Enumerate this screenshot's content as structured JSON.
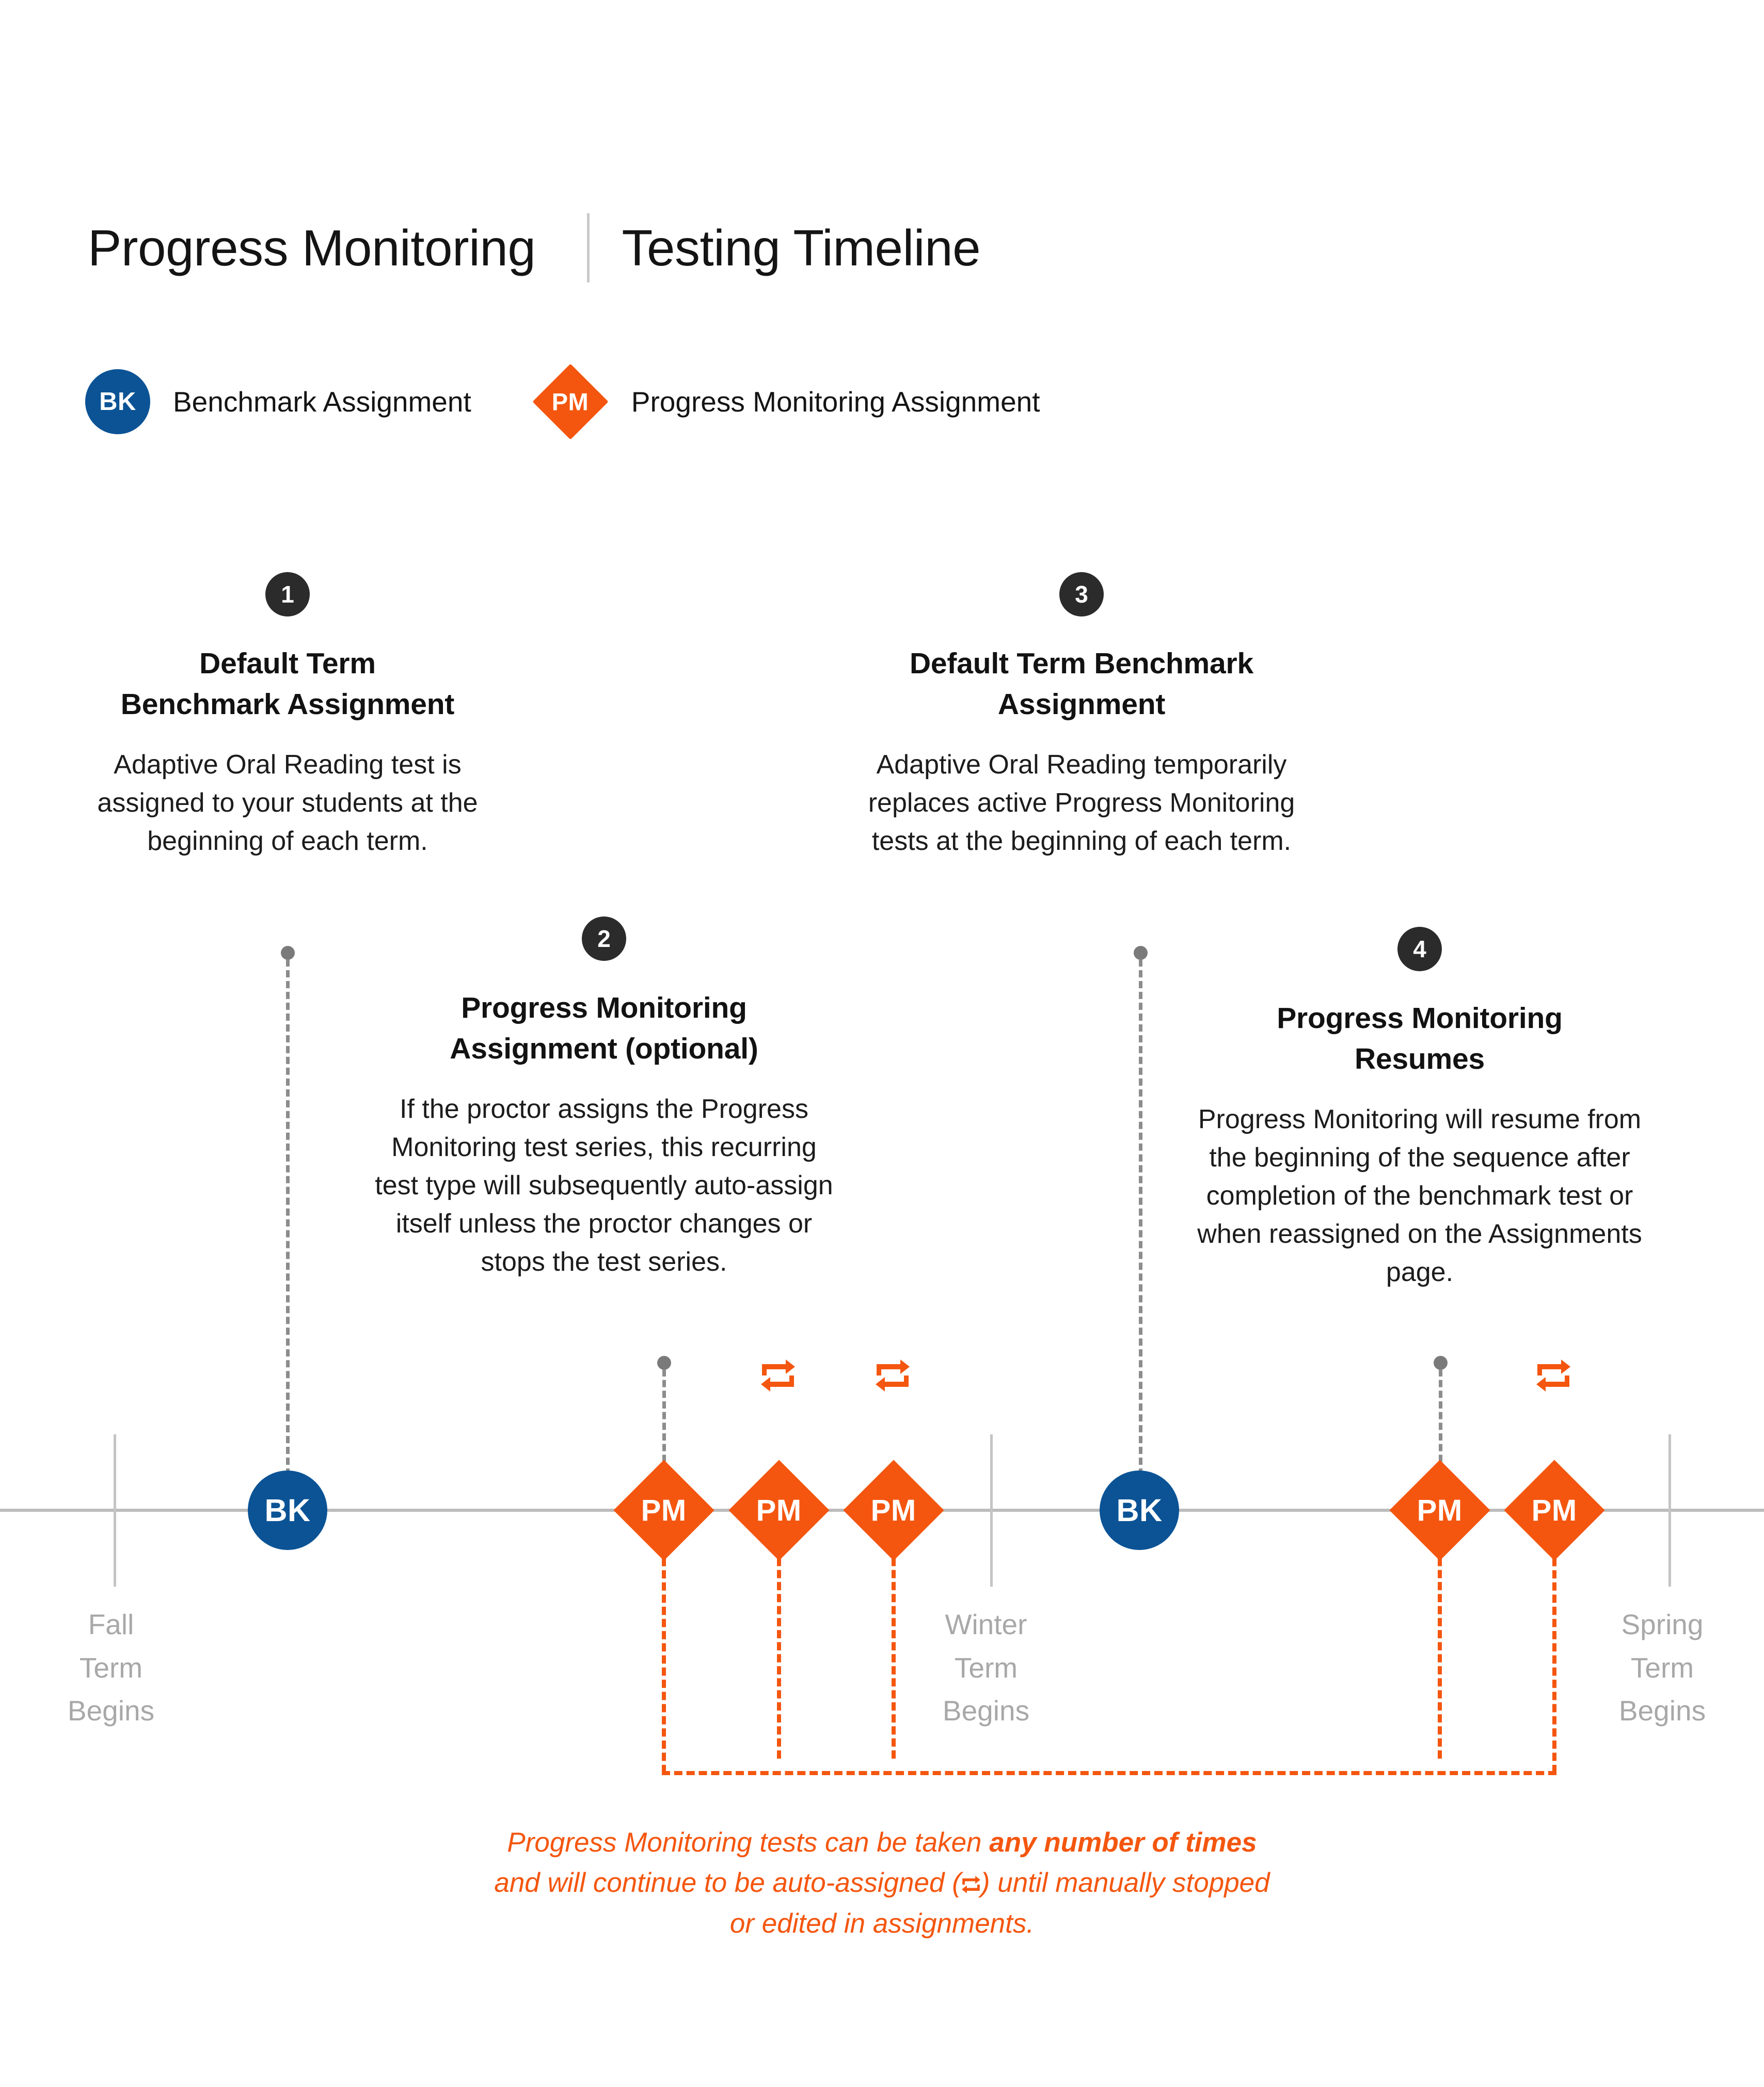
{
  "header": {
    "title": "Progress Monitoring",
    "subtitle": "Testing Timeline"
  },
  "legend": {
    "items": [
      {
        "code": "BK",
        "label": "Benchmark Assignment",
        "shape": "circle",
        "color": "#0b5395"
      },
      {
        "code": "PM",
        "label": "Progress Monitoring Assignment",
        "shape": "diamond",
        "color": "#f4560f"
      }
    ]
  },
  "steps": [
    {
      "number": "1",
      "title": "Default Term\nBenchmark Assignment",
      "title_lines": [
        "Default Term",
        "Benchmark Assignment"
      ],
      "body": "Adaptive Oral Reading test is assigned to your students at the beginning of each term."
    },
    {
      "number": "2",
      "title_lines": [
        "Progress Monitoring",
        "Assignment (optional)"
      ],
      "body": "If the proctor assigns the Progress Monitoring test series, this recurring test type will subsequently auto-assign itself unless the proctor changes or stops the test series."
    },
    {
      "number": "3",
      "title_lines": [
        "Default Term Benchmark",
        "Assignment"
      ],
      "body": "Adaptive Oral Reading temporarily replaces active Progress Monitoring tests at the beginning of each term."
    },
    {
      "number": "4",
      "title_lines": [
        "Progress Monitoring",
        "Resumes"
      ],
      "body": "Progress Monitoring will resume from the beginning of the sequence after completion of the benchmark test or when reassigned on the Assignments page."
    }
  ],
  "timeline": {
    "terms": [
      {
        "label_lines": [
          "Fall",
          "Term",
          "Begins"
        ]
      },
      {
        "label_lines": [
          "Winter",
          "Term",
          "Begins"
        ]
      },
      {
        "label_lines": [
          "Spring",
          "Term",
          "Begins"
        ]
      }
    ],
    "markers": [
      {
        "code": "BK",
        "type": "benchmark",
        "repeat": false
      },
      {
        "code": "PM",
        "type": "progress",
        "repeat": false
      },
      {
        "code": "PM",
        "type": "progress",
        "repeat": true
      },
      {
        "code": "PM",
        "type": "progress",
        "repeat": true
      },
      {
        "code": "BK",
        "type": "benchmark",
        "repeat": false
      },
      {
        "code": "PM",
        "type": "progress",
        "repeat": false
      },
      {
        "code": "PM",
        "type": "progress",
        "repeat": true
      }
    ]
  },
  "footnote": {
    "part1": "Progress Monitoring tests can be taken ",
    "emphasis": "any number of times",
    "part2": "and will continue to be auto-assigned (",
    "part3": ") until manually stopped",
    "part4": "or edited in assignments."
  },
  "colors": {
    "benchmark_blue": "#0b5395",
    "progress_orange": "#f4560f",
    "step_dark": "#2b2b2b",
    "axis_gray": "#bcbcbc",
    "term_label_gray": "#a8a8a8"
  }
}
